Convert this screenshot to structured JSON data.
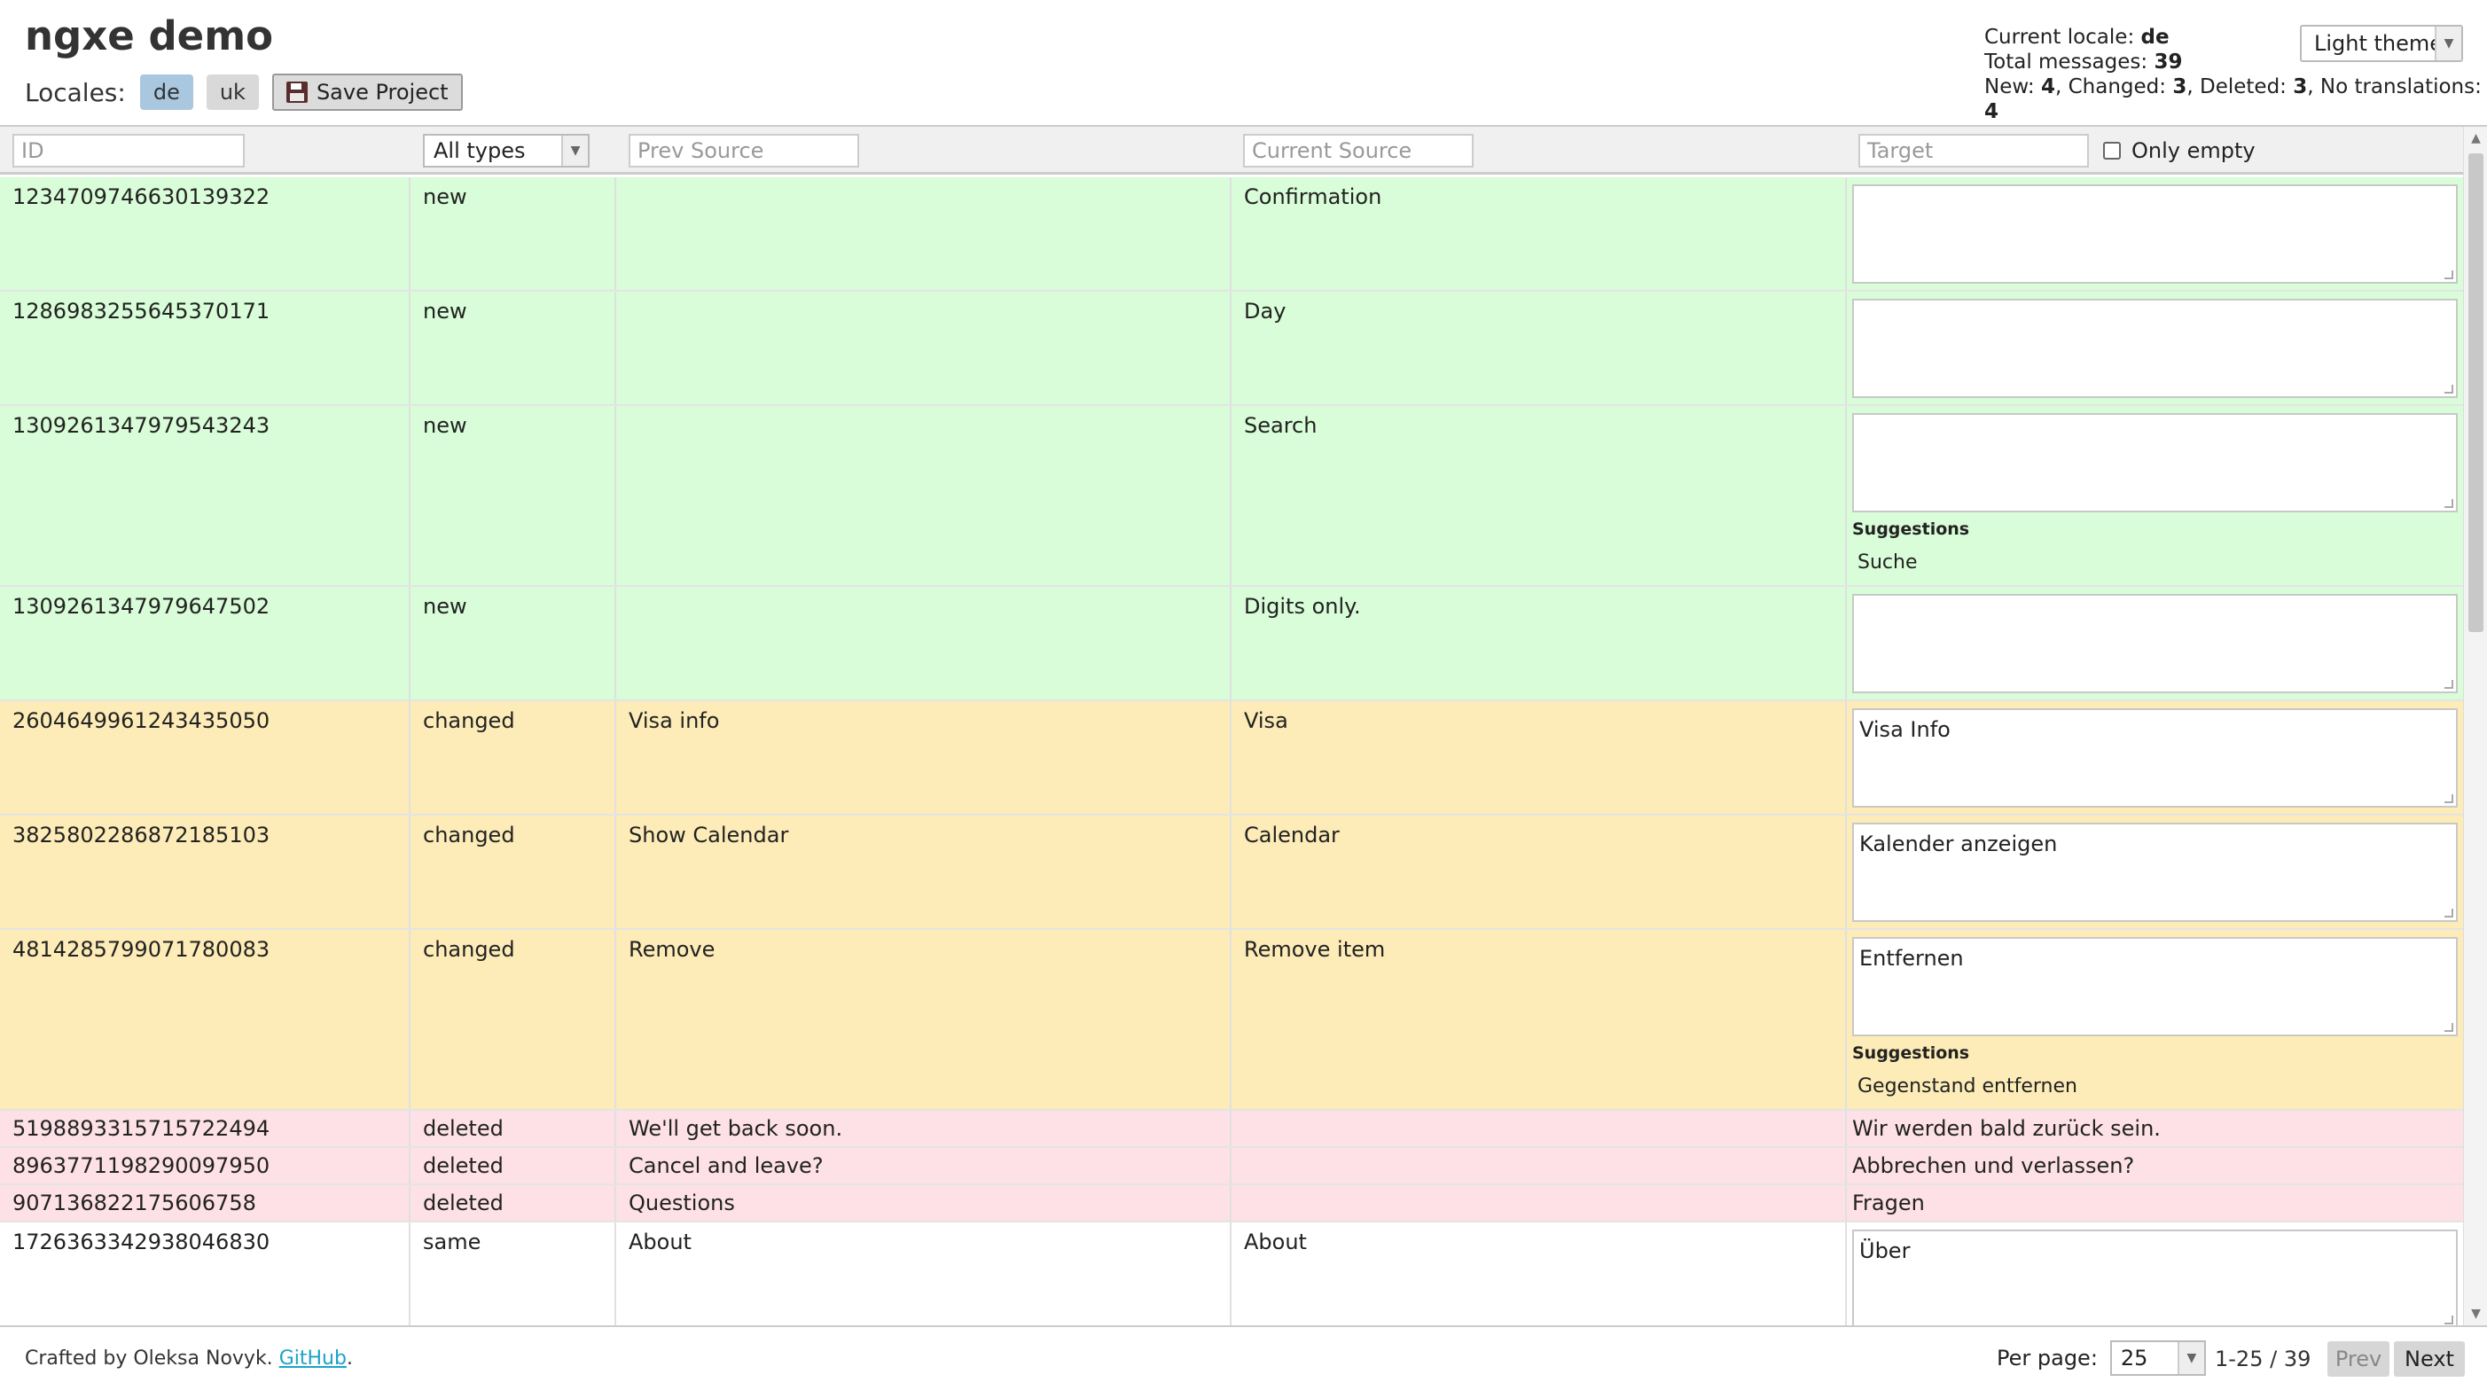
{
  "header": {
    "title": "ngxe demo",
    "locales_label": "Locales:",
    "locales": [
      "de",
      "uk"
    ],
    "save_label": "Save Project",
    "theme": "Light theme"
  },
  "stats": {
    "current_locale_label": "Current locale:",
    "current_locale": "de",
    "total_label": "Total messages:",
    "total": "39",
    "new_label": "New:",
    "new": "4",
    "changed_label": "Changed:",
    "changed": "3",
    "deleted_label": "Deleted:",
    "deleted": "3",
    "no_trans_label": "No translations:",
    "no_trans": "4"
  },
  "filters": {
    "id_placeholder": "ID",
    "type_value": "All types",
    "prev_placeholder": "Prev Source",
    "current_placeholder": "Current Source",
    "target_placeholder": "Target",
    "only_empty_label": "Only empty"
  },
  "rows": [
    {
      "id": "1234709746630139322",
      "type": "new",
      "prev": "",
      "current": "Confirmation",
      "target": ""
    },
    {
      "id": "1286983255645370171",
      "type": "new",
      "prev": "",
      "current": "Day",
      "target": ""
    },
    {
      "id": "1309261347979543243",
      "type": "new",
      "prev": "",
      "current": "Search",
      "target": "",
      "suggestions_title": "Suggestions",
      "suggestion": "Suche"
    },
    {
      "id": "1309261347979647502",
      "type": "new",
      "prev": "",
      "current": "Digits only.",
      "target": ""
    },
    {
      "id": "2604649961243435050",
      "type": "changed",
      "prev": "Visa info",
      "current": "Visa",
      "target": "Visa Info"
    },
    {
      "id": "3825802286872185103",
      "type": "changed",
      "prev": "Show Calendar",
      "current": "Calendar",
      "target": "Kalender anzeigen"
    },
    {
      "id": "4814285799071780083",
      "type": "changed",
      "prev": "Remove",
      "current": "Remove item",
      "target": "Entfernen",
      "suggestions_title": "Suggestions",
      "suggestion": "Gegenstand entfernen"
    },
    {
      "id": "5198893315715722494",
      "type": "deleted",
      "prev": "We'll get back soon.",
      "current": "",
      "target": "Wir werden bald zurück sein."
    },
    {
      "id": "8963771198290097950",
      "type": "deleted",
      "prev": "Cancel and leave?",
      "current": "",
      "target": "Abbrechen und verlassen?"
    },
    {
      "id": "907136822175606758",
      "type": "deleted",
      "prev": "Questions",
      "current": "",
      "target": "Fragen"
    },
    {
      "id": "1726363342938046830",
      "type": "same",
      "prev": "About",
      "current": "About",
      "target": "Über"
    }
  ],
  "footer": {
    "credit_text": "Crafted by Oleksa Novyk.",
    "github_label": "GitHub",
    "credit_end": ".",
    "per_page_label": "Per page:",
    "per_page": "25",
    "range": "1-25 / 39",
    "prev_label": "Prev",
    "next_label": "Next"
  },
  "colors": {
    "new": "#d8fdd8",
    "changed": "#fdecb7",
    "deleted": "#fde1e6",
    "active_locale": "#a9c7de",
    "link": "#1aa3c8"
  }
}
